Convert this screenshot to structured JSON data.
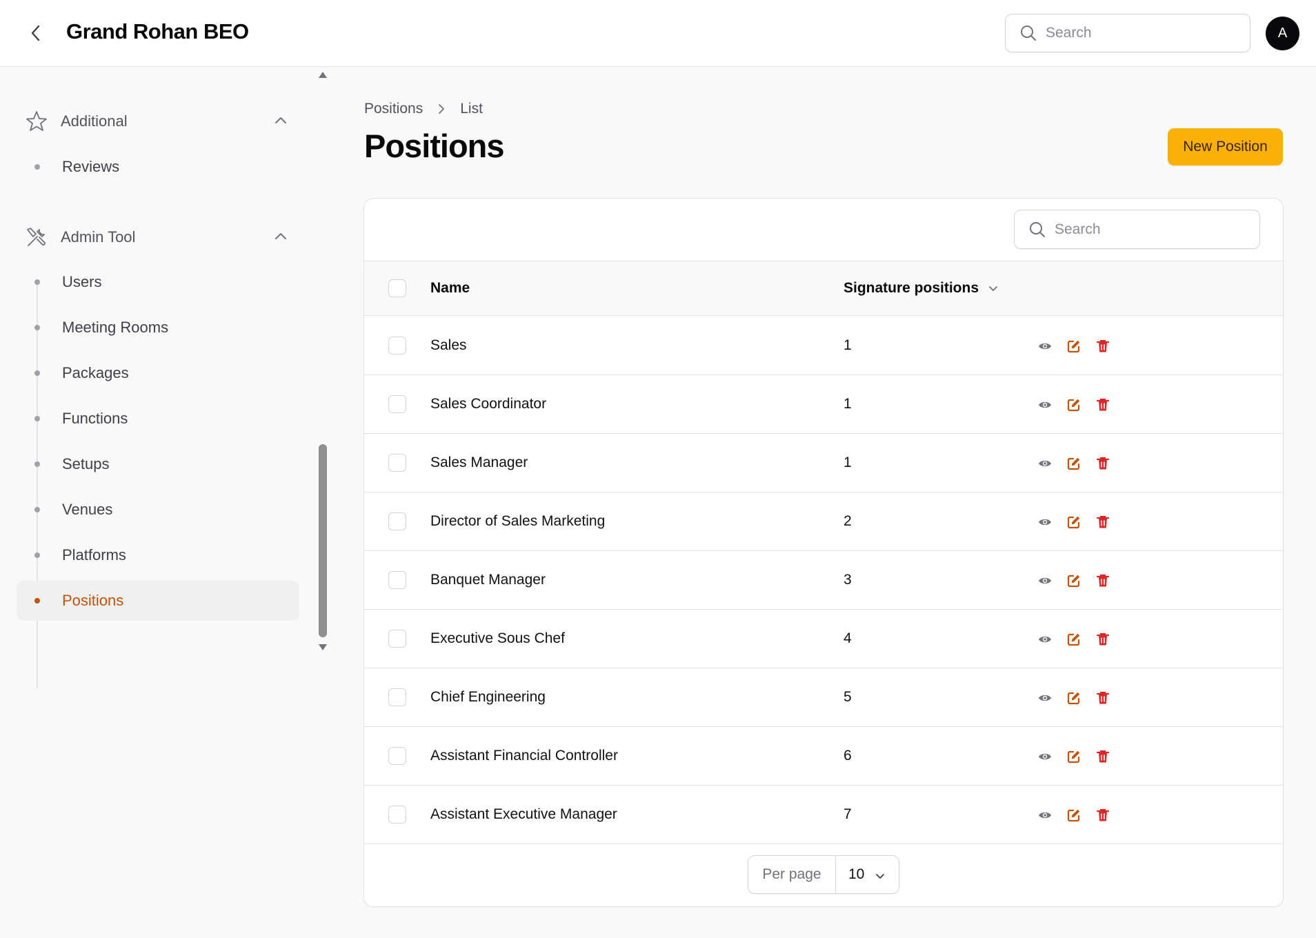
{
  "header": {
    "title": "Grand Rohan BEO",
    "search_placeholder": "Search",
    "avatar_initial": "A"
  },
  "sidebar": {
    "groups": [
      {
        "label": "Additional",
        "icon": "star-icon",
        "items": [
          {
            "label": "Reviews",
            "active": false
          }
        ]
      },
      {
        "label": "Admin Tool",
        "icon": "tools-icon",
        "items": [
          {
            "label": "Users",
            "active": false
          },
          {
            "label": "Meeting Rooms",
            "active": false
          },
          {
            "label": "Packages",
            "active": false
          },
          {
            "label": "Functions",
            "active": false
          },
          {
            "label": "Setups",
            "active": false
          },
          {
            "label": "Venues",
            "active": false
          },
          {
            "label": "Platforms",
            "active": false
          },
          {
            "label": "Positions",
            "active": true
          }
        ]
      }
    ]
  },
  "breadcrumb": [
    "Positions",
    "List"
  ],
  "page": {
    "title": "Positions",
    "new_button": "New Position"
  },
  "table": {
    "search_placeholder": "Search",
    "columns": [
      "Name",
      "Signature positions"
    ],
    "rows": [
      {
        "name": "Sales",
        "signature_positions": "1"
      },
      {
        "name": "Sales Coordinator",
        "signature_positions": "1"
      },
      {
        "name": "Sales Manager",
        "signature_positions": "1"
      },
      {
        "name": "Director of Sales Marketing",
        "signature_positions": "2"
      },
      {
        "name": "Banquet Manager",
        "signature_positions": "3"
      },
      {
        "name": "Executive Sous Chef",
        "signature_positions": "4"
      },
      {
        "name": "Chief Engineering",
        "signature_positions": "5"
      },
      {
        "name": "Assistant Financial Controller",
        "signature_positions": "6"
      },
      {
        "name": "Assistant Executive Manager",
        "signature_positions": "7"
      }
    ],
    "row_actions": [
      "view-icon",
      "edit-icon",
      "delete-icon"
    ],
    "per_page_label": "Per page",
    "per_page_value": "10"
  },
  "colors": {
    "accent": "#fbb008",
    "active_nav": "#c2530a",
    "edit": "#c2530a",
    "delete": "#dc2626",
    "view": "#71717a"
  }
}
